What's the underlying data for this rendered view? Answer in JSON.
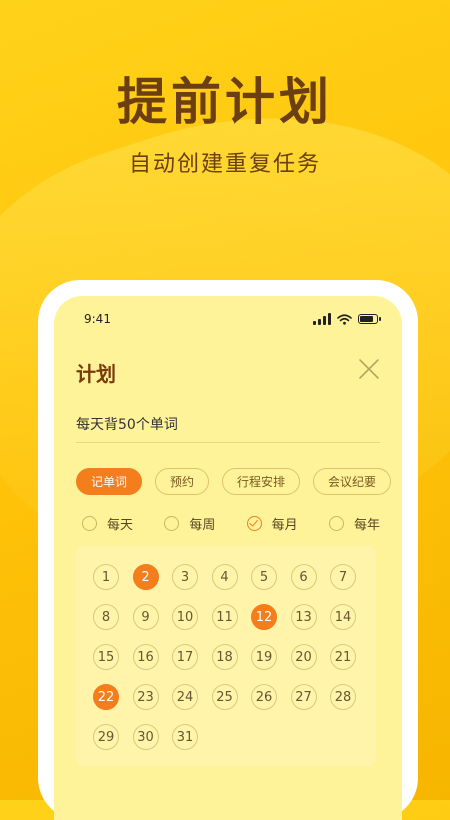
{
  "hero": {
    "title": "提前计划",
    "subtitle": "自动创建重复任务"
  },
  "status_bar": {
    "time": "9:41"
  },
  "plan": {
    "title": "计划",
    "task_value": "每天背50个单词",
    "tags": [
      {
        "label": "记单词",
        "active": true
      },
      {
        "label": "预约",
        "active": false
      },
      {
        "label": "行程安排",
        "active": false
      },
      {
        "label": "会议纪要",
        "active": false
      }
    ],
    "frequency": [
      {
        "label": "每天",
        "checked": false
      },
      {
        "label": "每周",
        "checked": false
      },
      {
        "label": "每月",
        "checked": true
      },
      {
        "label": "每年",
        "checked": false
      }
    ],
    "calendar_days": [
      1,
      2,
      3,
      4,
      5,
      6,
      7,
      8,
      9,
      10,
      11,
      12,
      13,
      14,
      15,
      16,
      17,
      18,
      19,
      20,
      21,
      22,
      23,
      24,
      25,
      26,
      27,
      28,
      29,
      30,
      31
    ],
    "selected_days": [
      2,
      12,
      22
    ]
  },
  "colors": {
    "accent": "#f47d1c",
    "title_brown": "#6b3f12",
    "screen_bg": "#fff39a"
  }
}
